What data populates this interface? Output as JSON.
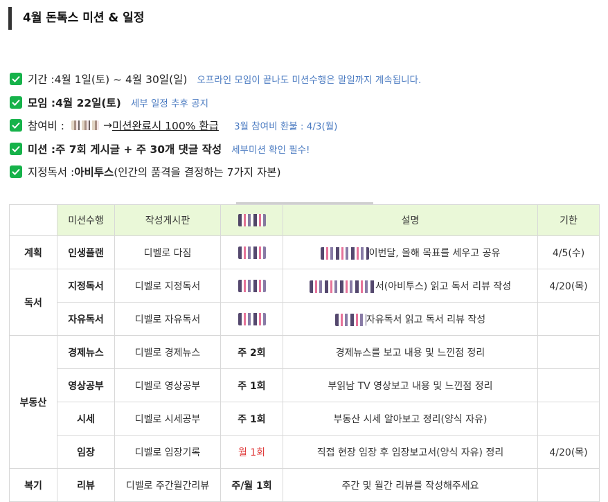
{
  "title": "4월 돈톡스 미션 & 일정",
  "bullets": {
    "period": {
      "label": "기간 : ",
      "value": "4월 1일(토) ~ 4월 30일(일)",
      "note": "오프라인 모임이 끝나도 미션수행은 말일까지 계속됩니다."
    },
    "meeting": {
      "label": "모임 : ",
      "value": "4월 22일(토)",
      "note": "세부 일정 추후 공지"
    },
    "fee": {
      "label": "참여비 : ",
      "arrow": "→ ",
      "value": "미션완료시 100% 환급",
      "note": "3월 참여비 환불 : 4/3(월)"
    },
    "mission": {
      "label": "미션 : ",
      "value": "주 7회 게시글 + 주 30개 댓글 작성",
      "note": "세부미션 확인 필수!"
    },
    "book": {
      "label": "지정독서 : ",
      "title": "아비투스",
      "subtitle": "(인간의 품격을 결정하는 7가지 자본)"
    }
  },
  "table": {
    "headers": {
      "mission": "미션수행",
      "board": "작성게시판",
      "desc": "설명",
      "due": "기한"
    },
    "rows": [
      {
        "category": "계획",
        "item": "인생플랜",
        "board": "디벨로 다짐",
        "freq": "",
        "desc": "이번달, 올해 목표를 세우고 공유",
        "due": "4/5(수)"
      },
      {
        "category": "독서",
        "item": "지정독서",
        "board": "디벨로 지정독서",
        "freq": "",
        "desc": "서(아비투스) 읽고 독서 리뷰 작성",
        "due": "4/20(목)"
      },
      {
        "category": "",
        "item": "자유독서",
        "board": "디벨로 자유독서",
        "freq": "",
        "desc": "자유독서 읽고 독서 리뷰 작성",
        "due": ""
      },
      {
        "category": "부동산",
        "item": "경제뉴스",
        "board": "디벨로 경제뉴스",
        "freq": "주 2회",
        "desc": "경제뉴스를 보고 내용 및 느낀점 정리",
        "due": ""
      },
      {
        "category": "",
        "item": "영상공부",
        "board": "디벨로 영상공부",
        "freq": "주 1회",
        "desc": "부읽남 TV 영상보고 내용 및 느낀점 정리",
        "due": ""
      },
      {
        "category": "",
        "item": "시세",
        "board": "디벨로 시세공부",
        "freq": "주 1회",
        "desc": "부동산 시세 알아보고 정리(양식 자유)",
        "due": ""
      },
      {
        "category": "",
        "item": "임장",
        "board": "디벨로 임장기록",
        "freq": "월 1회",
        "desc": "직접 현장 임장 후 임장보고서(양식 자유) 정리",
        "due": "4/20(목)"
      },
      {
        "category": "복기",
        "item": "리뷰",
        "board": "디벨로 주간월간리뷰",
        "freq": "주/월 1회",
        "desc": "주간 및 월간 리뷰를 작성해주세요",
        "due": ""
      }
    ]
  },
  "colors": {
    "check": "#16b24a",
    "note": "#4b7bc1",
    "header_bg": "#eaf8d8",
    "red": "#e03a3a"
  }
}
